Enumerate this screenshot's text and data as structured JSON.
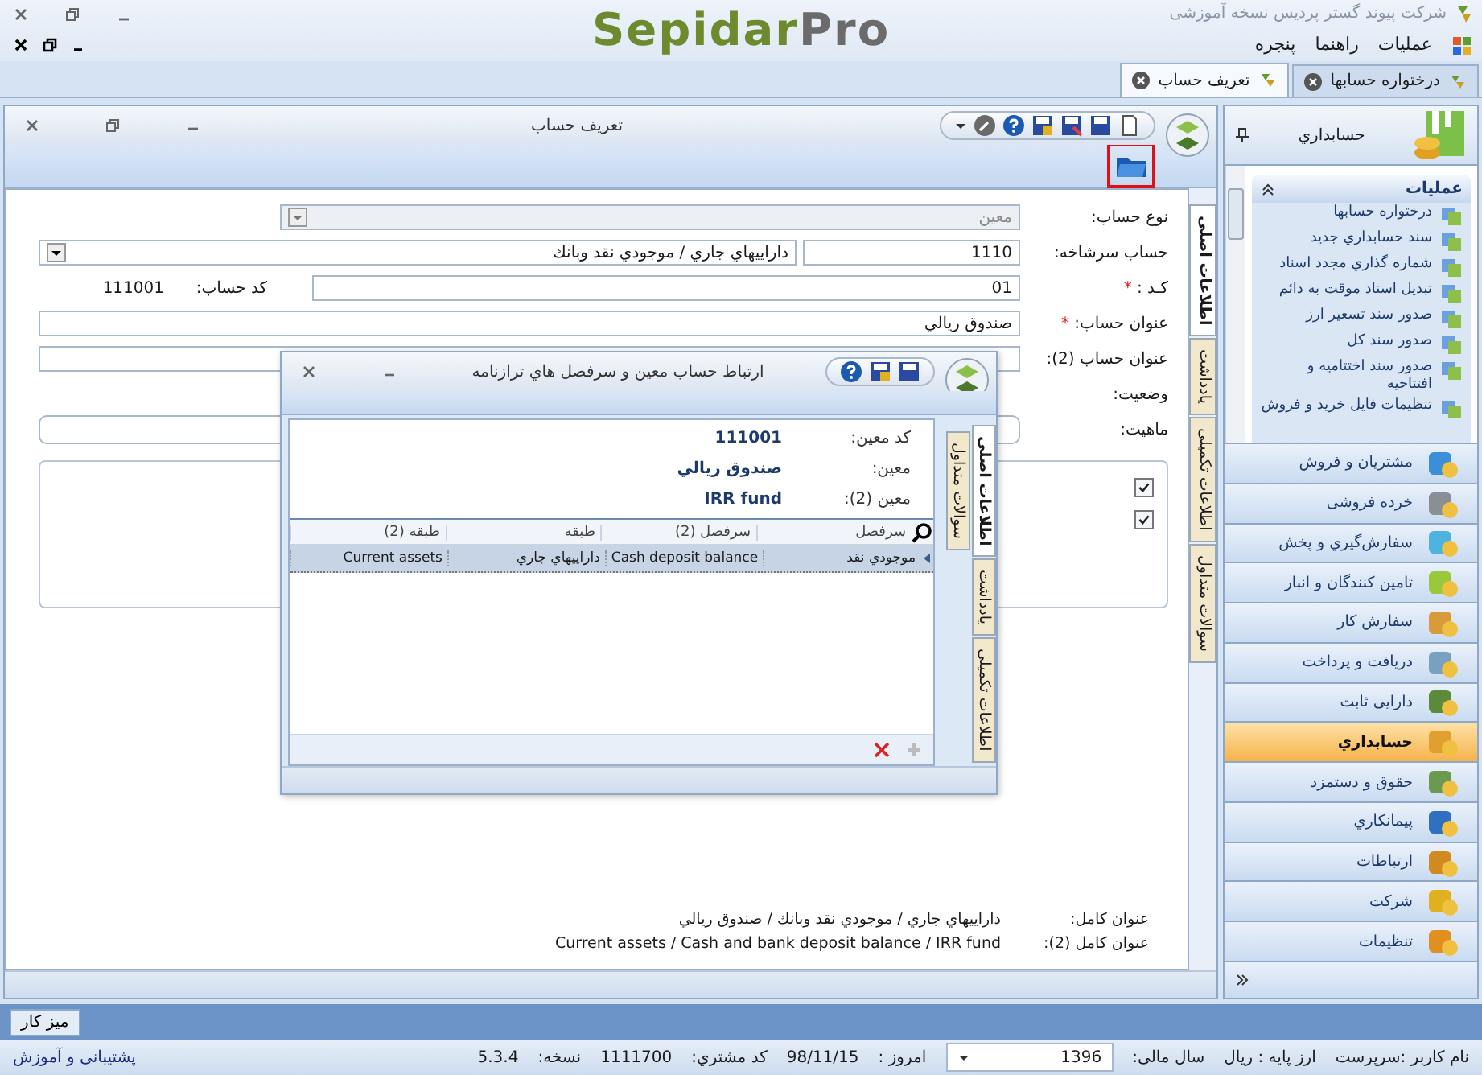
{
  "app": {
    "title": "شرکت پیوند گستر پردیس نسخه آموزشی",
    "logo_part_1": "Sepidar",
    "logo_part_2": "Pro"
  },
  "menu": [
    "عملیات",
    "راهنما",
    "پنجره"
  ],
  "tabs": [
    {
      "label": "درختواره حسابها",
      "selected": false
    },
    {
      "label": "تعریف حساب",
      "selected": true
    }
  ],
  "child_window": {
    "title": "تعریف حساب",
    "side_tabs": [
      {
        "label": "اطلاعات اصلی",
        "selected": true
      },
      {
        "label": "یادداشت",
        "selected": false
      },
      {
        "label": "اطلاعات تکمیلی",
        "selected": false
      },
      {
        "label": "سوالات متداول",
        "selected": false
      }
    ],
    "form": {
      "account_type": {
        "label": "نوع حساب:",
        "value": "معین",
        "disabled": true
      },
      "parent": {
        "label": "حساب سرشاخه:",
        "code": "1110",
        "name": "داراييهاي جاري / موجودي نقد وبانك"
      },
      "code": {
        "label": "کـد :",
        "required_mark": "*",
        "value": "01",
        "account_code_label": "کد حساب:",
        "account_code": "111001"
      },
      "title": {
        "label": "عنوان حساب:",
        "required_mark": "*",
        "value": "صندوق ريالي"
      },
      "title_2": {
        "label": "عنوان حساب (2):"
      },
      "status": {
        "label": "وضعیت:"
      },
      "nature": {
        "label": "ماهیت:"
      },
      "checkboxes": [
        {
          "checked": true
        },
        {
          "checked": true
        }
      ],
      "full_title": {
        "label": "عنوان کامل:",
        "value": "داراييهاي جاري / موجودي نقد وبانك / صندوق ريالي"
      },
      "full_title_2": {
        "label": "عنوان کامل (2):",
        "value": "Current assets / Cash and bank deposit balance / IRR fund"
      }
    }
  },
  "dialog": {
    "title": "ارتباط حساب معین و سرفصل هاي ترازنامه",
    "info": [
      {
        "label": "کد معین:",
        "value": "111001"
      },
      {
        "label": "معین:",
        "value": "صندوق ريالي"
      },
      {
        "label": "معین (2):",
        "value": "IRR fund"
      }
    ],
    "table": {
      "columns": [
        "سرفصل",
        "سرفصل (2)",
        "طبقه",
        "طبقه (2)"
      ],
      "rows": [
        {
          "selected": true,
          "cells": [
            "موجودي نقد",
            "Cash deposit balance",
            "داراييهاي جاري",
            "Current assets"
          ]
        }
      ]
    },
    "side_tabs": [
      {
        "label": "اطلاعات اصلی",
        "selected": true
      },
      {
        "label": "یادداشت",
        "selected": false
      },
      {
        "label": "اطلاعات تکمیلی",
        "selected": false
      }
    ],
    "faq_tab": "سوالات متداول"
  },
  "nav_pane": {
    "title": "حسابداري",
    "group_title": "عملیات",
    "operations": [
      "درختواره حسابها",
      "سند حسابداري جديد",
      "شماره گذاري مجدد اسناد",
      "تبديل اسناد موقت به دائم",
      "صدور سند تسعير ارز",
      "صدور سند کل",
      "صدور سند اختتاميه و افتتاحيه",
      "تنظیمات فایل خرید و فروش"
    ],
    "modules": [
      {
        "label": "مشتریان و فروش",
        "selected": false
      },
      {
        "label": "خرده فروشی",
        "selected": false
      },
      {
        "label": "سفارش‌گیري و پخش",
        "selected": false
      },
      {
        "label": "تامین کنندگان و انبار",
        "selected": false
      },
      {
        "label": "سفارش کار",
        "selected": false
      },
      {
        "label": "دریافت و پرداخت",
        "selected": false
      },
      {
        "label": "دارایی ثابت",
        "selected": false
      },
      {
        "label": "حسابداري",
        "selected": true
      },
      {
        "label": "حقوق و دستمزد",
        "selected": false
      },
      {
        "label": "پیمانکاري",
        "selected": false
      },
      {
        "label": "ارتباطات",
        "selected": false
      },
      {
        "label": "شرکت",
        "selected": false
      },
      {
        "label": "تنظیمات",
        "selected": false
      }
    ]
  },
  "desktop_button": "میز کار",
  "status_bar": {
    "user": "نام کاربر :سرپرست",
    "currency": "ارز پایه :  ریال",
    "fiscal_year_label": "سال مالی:",
    "fiscal_year": "1396",
    "today_label": "امروز :",
    "today": "98/11/15",
    "customer_code_label": "کد مشتري:",
    "customer_code": "1111700",
    "version_label": "نسخه:",
    "version": "5.3.4",
    "support_link": "پشتیبانی و آموزش"
  }
}
